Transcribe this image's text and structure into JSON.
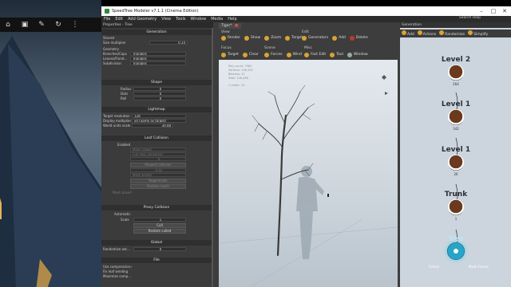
{
  "desktop": {
    "icons": [
      "house-icon",
      "camera-icon",
      "pen-icon",
      "refresh-icon",
      "dots-icon"
    ]
  },
  "window": {
    "title": "SpeedTree Modeler v7.1.1 (Cinema Edition)",
    "search_help": "Search Help"
  },
  "menu": [
    "File",
    "Edit",
    "Add Geometry",
    "View",
    "Tools",
    "Window",
    "Media",
    "Help"
  ],
  "properties": {
    "header": "Properties - Tree",
    "generation": {
      "title": "Generation",
      "shared": "Shared",
      "size_label": "Size multiplier",
      "size_value": "0.14",
      "geometry": "Geometry",
      "rows": [
        {
          "label": "Branches/Caps",
          "value": "Triangles"
        },
        {
          "label": "Leaves/Frond...",
          "value": "Triangles"
        },
        {
          "label": "Subdivision",
          "value": "Triangles"
        }
      ]
    },
    "shape": {
      "title": "Shape",
      "rows": [
        {
          "label": "Radius",
          "value": "0"
        },
        {
          "label": "Dots",
          "value": "0"
        },
        {
          "label": "Roll",
          "value": "0"
        }
      ]
    },
    "lightmap": {
      "title": "Lightmap",
      "rows": [
        {
          "label": "Target resolution",
          "value": "128"
        },
        {
          "label": "Display multiplier",
          "value": "x4 (Same as target)"
        },
        {
          "label": "World units scale",
          "value": "30.48"
        }
      ]
    },
    "leaf_collision": {
      "title": "Leaf Collision",
      "enabled": "Enabled",
      "rows": [
        {
          "label": "Mode",
          "value": "Mesh (slow)"
        },
        {
          "label": "Accuracy",
          "value": "Full (less sensitive)"
        },
        {
          "label": "Sample radius",
          "value": "0"
        },
        {
          "label": "",
          "value": "Respect collision"
        },
        {
          "label": "Cell spacing",
          "value": "0.42"
        },
        {
          "label": "Collision dist...",
          "value": "Mesh based"
        },
        {
          "label": "",
          "value": "Regenerate"
        },
        {
          "label": "",
          "value": "Position mesh"
        },
        {
          "label": "Mesh based",
          "value": ""
        }
      ]
    },
    "proxy_collision": {
      "title": "Proxy Collision",
      "automatic": "Automatic",
      "scale_label": "Scale",
      "scale_value": "1",
      "cull": "Cull",
      "restore": "Restore culled"
    },
    "global": {
      "title": "Global",
      "rand_label": "Randomize ext...",
      "rand_value": "0"
    },
    "file": {
      "title": "File",
      "rows": [
        "Use compression",
        "Fix leaf winding",
        "Maximize comp..."
      ]
    }
  },
  "viewport_tab": "Tiger*",
  "toolbar": {
    "view_label": "View",
    "view": [
      "Render",
      "Show",
      "Zoom",
      "Target"
    ],
    "edit_label": "Edit",
    "edit": [
      "Generators",
      "Add",
      "Delete"
    ],
    "focus_label": "Focus",
    "focus": [
      "Target",
      "Clear"
    ],
    "scene_label": "Scene",
    "scene": [
      "Forces",
      "Wind"
    ],
    "misc_label": "Misc",
    "misc": [
      "Fast Edit",
      "Tool",
      "Window"
    ]
  },
  "stats": {
    "lines": [
      "Poly count: 7984",
      "Vertices: 146,100",
      "Batches: 41",
      "Total: 146,486"
    ],
    "scale": "1 meter: 10"
  },
  "generation_panel": {
    "title": "Generation",
    "tools": [
      "Add",
      "Actions",
      "Randomize",
      "Simplify"
    ],
    "nodes": [
      {
        "name": "Level 2",
        "count": "264"
      },
      {
        "name": "Level 1",
        "count": "342"
      },
      {
        "name": "Level 1",
        "count": "26"
      },
      {
        "name": "Trunk",
        "count": "1"
      },
      {
        "name": "Tree",
        "count": ""
      }
    ],
    "footer": [
      "Forces",
      "Mesh Forces"
    ]
  },
  "colors": {
    "accent": "#d7a433",
    "node_ring": "#ffffff",
    "tree_node": "#27a5c8"
  }
}
